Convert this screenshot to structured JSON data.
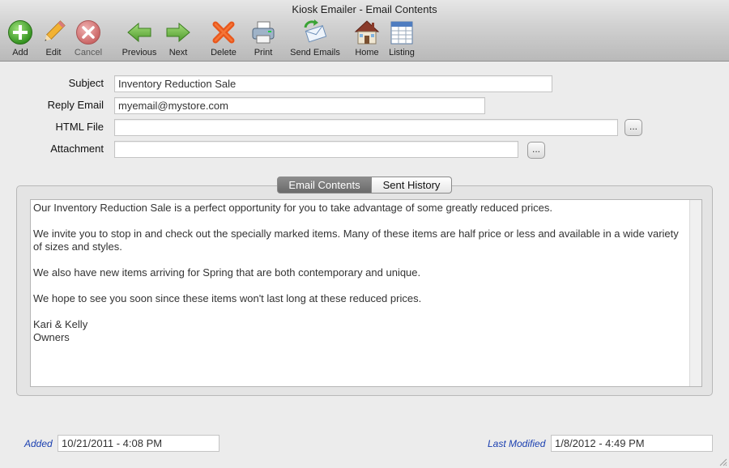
{
  "window": {
    "title": "Kiosk Emailer - Email Contents"
  },
  "toolbar": {
    "add": "Add",
    "edit": "Edit",
    "cancel": "Cancel",
    "previous": "Previous",
    "next": "Next",
    "delete": "Delete",
    "print": "Print",
    "send_emails": "Send Emails",
    "home": "Home",
    "listing": "Listing"
  },
  "form": {
    "subject_label": "Subject",
    "subject_value": "Inventory Reduction Sale",
    "reply_label": "Reply Email",
    "reply_value": "myemail@mystore.com",
    "html_label": "HTML File",
    "html_value": "",
    "attachment_label": "Attachment",
    "attachment_value": "",
    "browse_label": "..."
  },
  "tabs": {
    "active": "Email Contents",
    "inactive": "Sent History"
  },
  "email_body": {
    "p1": "Our Inventory Reduction Sale is a perfect opportunity for you to take advantage of some greatly reduced prices.",
    "p2": "We invite you to stop in and check out the specially marked items.  Many of these items are half price or less and available in a wide variety of sizes and styles.",
    "p3": "We also have new items arriving for Spring that are both contemporary and unique.",
    "p4": "We hope to see you soon since these items won't last long at these reduced prices.",
    "sig1": "Kari & Kelly",
    "sig2": "Owners"
  },
  "footer": {
    "added_label": "Added",
    "added_value": "10/21/2011 - 4:08 PM",
    "modified_label": "Last Modified",
    "modified_value": "1/8/2012 - 4:49 PM"
  },
  "colors": {
    "meta_label": "#1a3fb0",
    "active_tab": "#7a7a7a"
  },
  "icons": [
    "add-icon",
    "edit-icon",
    "cancel-icon",
    "previous-icon",
    "next-icon",
    "delete-icon",
    "print-icon",
    "send-emails-icon",
    "home-icon",
    "listing-icon"
  ]
}
